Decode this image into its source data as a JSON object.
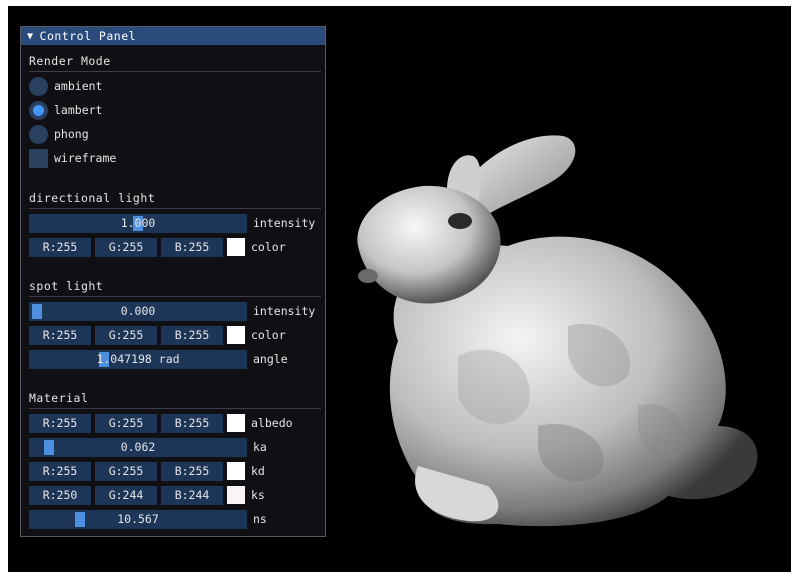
{
  "panel": {
    "title": "Control Panel",
    "title_icon": "triangle-down-icon",
    "render_mode": {
      "label": "Render Mode",
      "options": [
        {
          "label": "ambient",
          "selected": false
        },
        {
          "label": "lambert",
          "selected": true
        },
        {
          "label": "phong",
          "selected": false
        }
      ],
      "wireframe": {
        "label": "wireframe",
        "checked": false
      }
    },
    "directional_light": {
      "label": "directional light",
      "intensity": {
        "value": "1.000",
        "label": "intensity",
        "fraction": 0.5
      },
      "color": {
        "r": "R:255",
        "g": "G:255",
        "b": "B:255",
        "swatch": "#ffffff",
        "label": "color"
      }
    },
    "spot_light": {
      "label": "spot light",
      "intensity": {
        "value": "0.000",
        "label": "intensity",
        "fraction": 0.0
      },
      "color": {
        "r": "R:255",
        "g": "G:255",
        "b": "B:255",
        "swatch": "#ffffff",
        "label": "color"
      },
      "angle": {
        "value": "1.047198 rad",
        "label": "angle",
        "fraction": 0.333
      }
    },
    "material": {
      "label": "Material",
      "albedo": {
        "r": "R:255",
        "g": "G:255",
        "b": "B:255",
        "swatch": "#ffffff",
        "label": "albedo"
      },
      "ka": {
        "value": "0.062",
        "label": "ka",
        "fraction": 0.062
      },
      "kd": {
        "r": "R:255",
        "g": "G:255",
        "b": "B:255",
        "swatch": "#ffffff",
        "label": "kd"
      },
      "ks": {
        "r": "R:250",
        "g": "G:244",
        "b": "B:244",
        "swatch": "#faf4f4",
        "label": "ks"
      },
      "ns": {
        "value": "10.567",
        "label": "ns",
        "fraction": 0.22
      }
    }
  },
  "colors": {
    "panel_bg": "#0f0f14",
    "title_bg": "#294a7a",
    "widget_bg": "#1d3557",
    "accent": "#4296fa",
    "viewport_bg": "#000000"
  },
  "scene": {
    "object": "stanford-bunny"
  }
}
